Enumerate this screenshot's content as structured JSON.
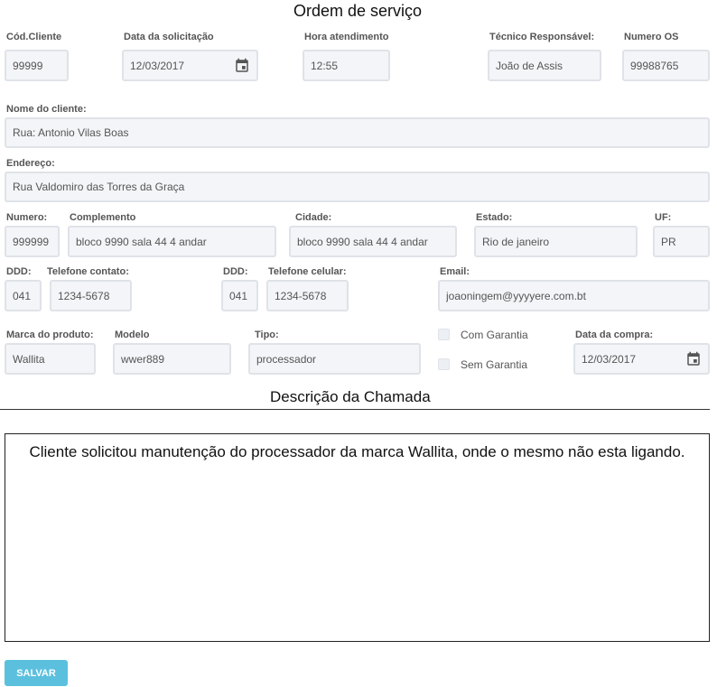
{
  "header": {
    "title": "Ordem de serviço"
  },
  "row1": {
    "cod_cliente": {
      "label": "Cód.Cliente",
      "value": "99999"
    },
    "data_solicitacao": {
      "label": "Data da solicitação",
      "value": "12/03/2017"
    },
    "hora_atendimento": {
      "label": "Hora atendimento",
      "value": "12:55"
    },
    "tecnico": {
      "label": "Técnico Responsável:",
      "value": "João de Assis"
    },
    "numero_os": {
      "label": "Numero OS",
      "value": "99988765"
    }
  },
  "nome_cliente": {
    "label": "Nome do cliente:",
    "value": "Rua: Antonio Vilas Boas"
  },
  "endereco": {
    "label": "Endereço:",
    "value": "Rua Valdomiro das Torres da Graça"
  },
  "row4": {
    "numero": {
      "label": "Numero:",
      "value": "999999"
    },
    "complemento": {
      "label": "Complemento",
      "value": "bloco 9990 sala 44 4 andar"
    },
    "cidade": {
      "label": "Cidade:",
      "value": "bloco 9990 sala 44 4 andar"
    },
    "estado": {
      "label": "Estado:",
      "value": "Rio de janeiro"
    },
    "uf": {
      "label": "UF:",
      "value": "PR"
    }
  },
  "row5": {
    "ddd1": {
      "label": "DDD:",
      "value": "041"
    },
    "telefone_contato": {
      "label": "Telefone contato:",
      "value": "1234-5678"
    },
    "ddd2": {
      "label": "DDD:",
      "value": "041"
    },
    "telefone_celular": {
      "label": "Telefone celular:",
      "value": "1234-5678"
    },
    "email": {
      "label": "Email:",
      "value": "joaoningem@yyyyere.com.bt"
    }
  },
  "row6": {
    "marca": {
      "label": "Marca do produto:",
      "value": "Wallita"
    },
    "modelo": {
      "label": "Modelo",
      "value": "wwer889"
    },
    "tipo": {
      "label": "Tipo:",
      "value": "processador"
    },
    "com_garantia": {
      "label": "Com Garantia",
      "checked": false
    },
    "sem_garantia": {
      "label": "Sem Garantia",
      "checked": false
    },
    "data_compra": {
      "label": "Data da compra:",
      "value": "12/03/2017"
    }
  },
  "descricao": {
    "title": "Descrição da Chamada",
    "text": "Cliente solicitou manutenção do processador da marca Wallita, onde o mesmo não esta ligando."
  },
  "actions": {
    "save_label": "SALVAR"
  },
  "icons": {
    "calendar": "calendar-icon"
  },
  "colors": {
    "button": "#5bc0de",
    "input_bg": "#f3f5f8",
    "input_border": "#dfe3e8"
  }
}
